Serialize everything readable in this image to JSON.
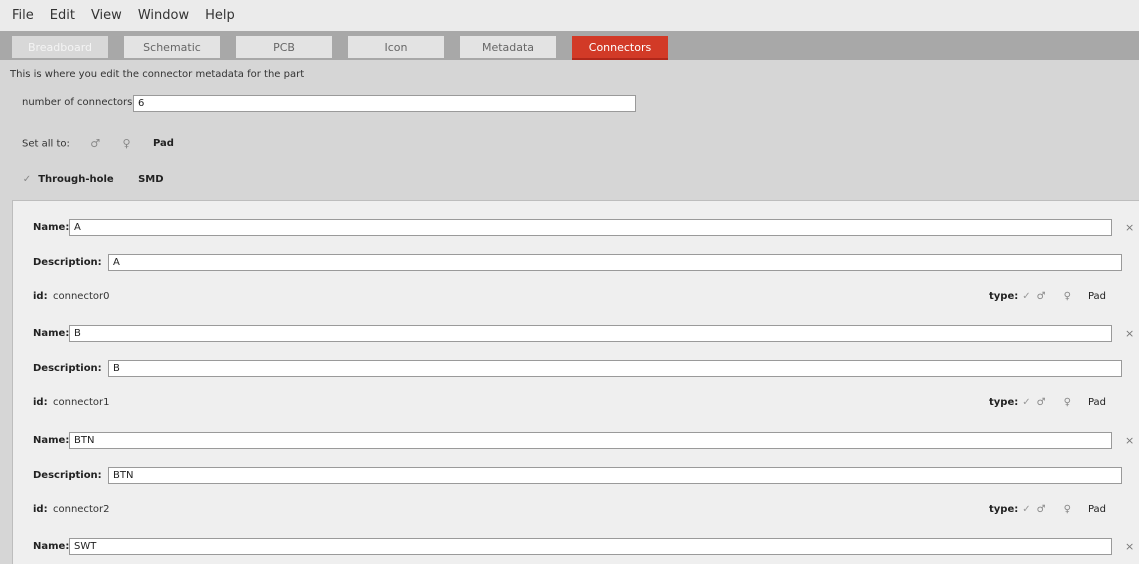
{
  "menu": [
    "File",
    "Edit",
    "View",
    "Window",
    "Help"
  ],
  "tabs": [
    {
      "label": "Breadboard",
      "state": "disabled"
    },
    {
      "label": "Schematic",
      "state": "normal"
    },
    {
      "label": "PCB",
      "state": "normal"
    },
    {
      "label": "Icon",
      "state": "normal"
    },
    {
      "label": "Metadata",
      "state": "normal"
    },
    {
      "label": "Connectors",
      "state": "active"
    }
  ],
  "hint": "This is where you edit the connector metadata for the part",
  "num_connectors": {
    "label": "number of connectors:",
    "value": "6"
  },
  "set_all": {
    "label": "Set all to:",
    "male_icon": "male-icon",
    "female_icon": "female-icon",
    "pad_label": "Pad"
  },
  "mount": {
    "check": "✓",
    "through_hole": "Through-hole",
    "smd": "SMD"
  },
  "labels": {
    "name": "Name:",
    "description": "Description:",
    "id": "id:",
    "type": "type:",
    "pad": "Pad",
    "close": "×",
    "check": "✓",
    "male": "♂",
    "female": "♀"
  },
  "connectors": [
    {
      "name": "A",
      "description": "A",
      "id": "connector0"
    },
    {
      "name": "B",
      "description": "B",
      "id": "connector1"
    },
    {
      "name": "BTN",
      "description": "BTN",
      "id": "connector2"
    },
    {
      "name": "SWT"
    }
  ],
  "colors": {
    "accent": "#d23a27",
    "panel": "#efefef",
    "background": "#d6d6d6"
  }
}
